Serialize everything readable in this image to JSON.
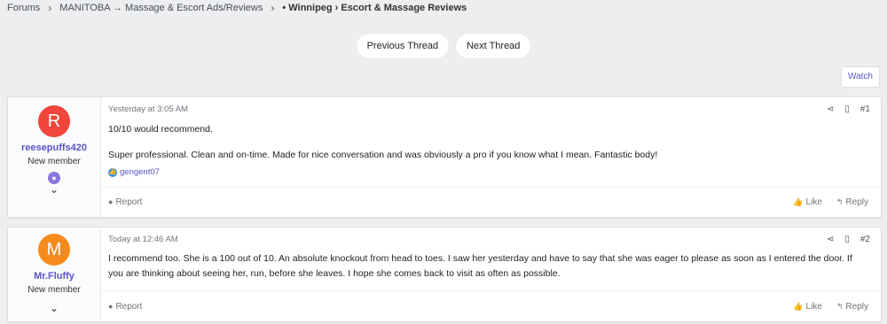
{
  "breadcrumb": {
    "items": [
      "Forums",
      "MANITOBA → Massage & Escort Ads/Reviews"
    ],
    "current": "• Winnipeg › Escort & Massage Reviews"
  },
  "nav": {
    "prev_label": "Previous Thread",
    "next_label": "Next Thread",
    "watch_label": "Watch"
  },
  "posts": [
    {
      "avatar_letter": "R",
      "avatar_color": "#f0463b",
      "username": "reesepuffs420",
      "user_title": "New member",
      "timestamp": "Yesterday at 3:05 AM",
      "post_number": "#1",
      "lines": [
        "10/10 would recommend.",
        "Super professional. Clean and on-time. Made for nice conversation and was obviously a pro if you know what I mean. Fantastic body!"
      ],
      "reaction_user": "gengent07",
      "report_label": "Report",
      "like_label": "Like",
      "reply_label": "Reply"
    },
    {
      "avatar_letter": "M",
      "avatar_color": "#f78a1d",
      "username": "Mr.Fluffy",
      "user_title": "New member",
      "timestamp": "Today at 12:46 AM",
      "post_number": "#2",
      "lines": [
        "I recommend too. She is a 100 out of 10. An absolute knockout from head to toes. I saw her yesterday and have to say that she was eager to please as soon as I entered the door. If you are thinking about seeing her, run, before she leaves. I hope she comes back to visit as often as possible."
      ],
      "report_label": "Report",
      "like_label": "Like",
      "reply_label": "Reply"
    }
  ],
  "icons": {
    "share": "share-icon",
    "bookmark": "bookmark-icon",
    "chevron": "chevron-down-icon",
    "report": "report-icon",
    "like": "like-icon",
    "reply": "reply-icon"
  }
}
